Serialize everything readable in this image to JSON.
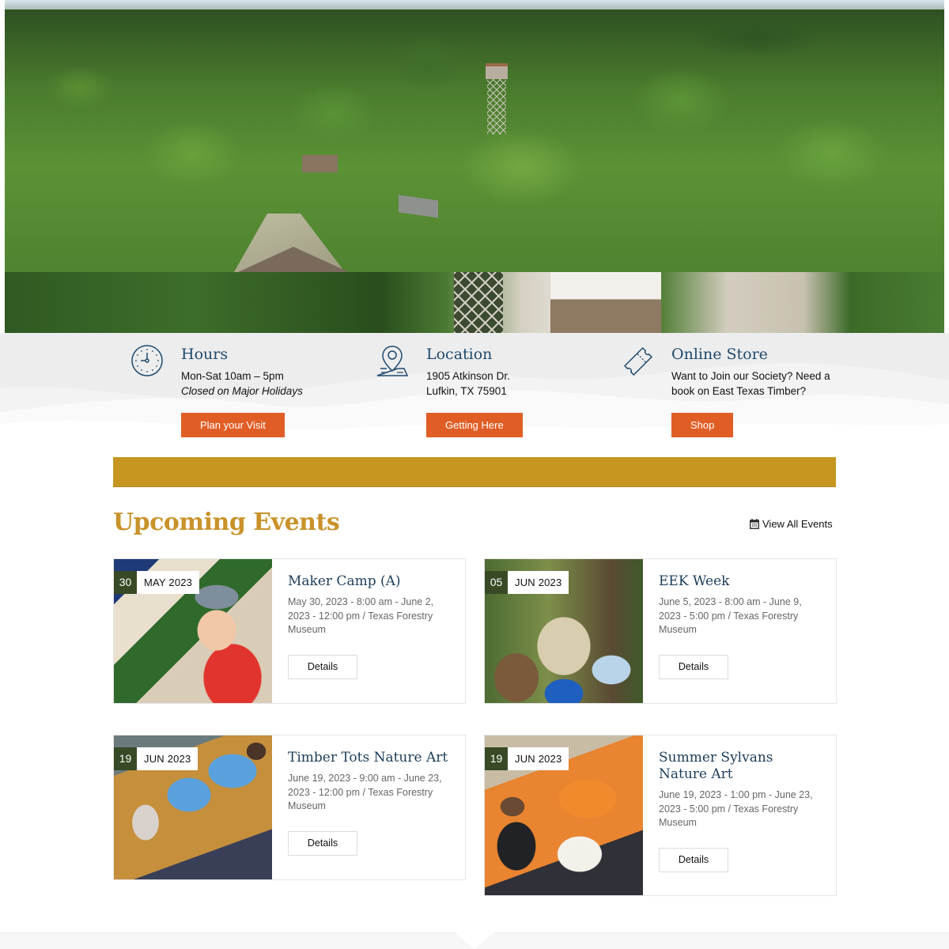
{
  "hero": {
    "alt": "Aerial view of forest with fire lookout tower"
  },
  "info": {
    "columns": [
      {
        "icon": "clock-icon",
        "title": "Hours",
        "line1": "Mon-Sat 10am – 5pm",
        "line2": "Closed on Major Holidays",
        "button": "Plan your Visit"
      },
      {
        "icon": "map-pin-icon",
        "title": "Location",
        "line1": "1905 Atkinson Dr.",
        "line2": "Lufkin, TX 75901",
        "button": "Getting Here"
      },
      {
        "icon": "ticket-icon",
        "title": "Online Store",
        "line1": "Want to Join our Society?  Need a",
        "line2": "book on East Texas Timber?",
        "button": "Shop"
      }
    ]
  },
  "colors": {
    "accent_orange": "#e05e26",
    "gold": "#c79620",
    "title_blue": "#1e4a6e",
    "badge_green": "#374a25",
    "events_heading": "#c9922a"
  },
  "events": {
    "heading": "Upcoming Events",
    "view_all": "View All Events",
    "view_all_icon": "calendar-icon",
    "items": [
      {
        "day": "30",
        "month": "MAY 2023",
        "title": "Maker Camp (A)",
        "meta": "May 30, 2023 - 8:00 am - June 2, 2023 - 12:00 pm / Texas Forestry Museum",
        "button": "Details"
      },
      {
        "day": "05",
        "month": "JUN 2023",
        "title": "EEK Week",
        "meta": "June 5, 2023 - 8:00 am - June 9, 2023 - 5:00 pm / Texas Forestry Museum",
        "button": "Details"
      },
      {
        "day": "19",
        "month": "JUN 2023",
        "title": "Timber Tots Nature Art",
        "meta": "June 19, 2023 - 9:00 am - June 23, 2023 - 12:00 pm / Texas Forestry Museum",
        "button": "Details"
      },
      {
        "day": "19",
        "month": "JUN 2023",
        "title": "Summer Sylvans Nature Art",
        "meta": "June 19, 2023 - 1:00 pm - June 23, 2023 - 5:00 pm / Texas Forestry Museum",
        "button": "Details"
      }
    ]
  }
}
